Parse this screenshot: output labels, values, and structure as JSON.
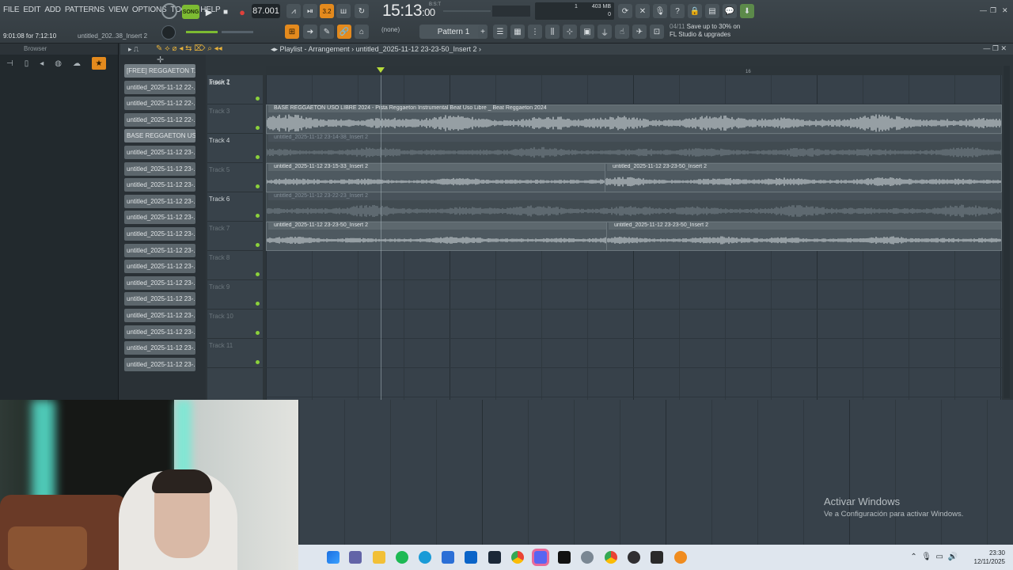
{
  "menu": [
    "FILE",
    "EDIT",
    "ADD",
    "PATTERNS",
    "VIEW",
    "OPTIONS",
    "TOOLS",
    "HELP"
  ],
  "transport": {
    "song_label": "SONG",
    "tempo": "87.001",
    "time": "15:13",
    "time_small": ":00",
    "time_meta": "B:S:T"
  },
  "status": {
    "position": "9:01:08 for 7:12:10",
    "file": "untitled_202..38_Insert 2"
  },
  "cpu": {
    "memory": "403 MB",
    "cpu_val": "1",
    "poly": "0"
  },
  "pattern": {
    "none_label": "(none)",
    "selected": "Pattern 1"
  },
  "promo": {
    "count": "04/11",
    "line1": "Save up to 30% on",
    "line2": "FL Studio & upgrades"
  },
  "browser": {
    "title": "Browser"
  },
  "playlist": {
    "title": "Playlist - Arrangement",
    "breadcrumb": "untitled_2025-11-12 23-23-50_Insert 2",
    "ruler_mark": "16",
    "clips_list": [
      "[FREE] REGGAETON T...",
      "untitled_2025-11-12 22-...",
      "untitled_2025-11-12 22-...",
      "untitled_2025-11-12 22-...",
      "BASE REGGAETON US...",
      "untitled_2025-11-12 23-...",
      "untitled_2025-11-12 23-...",
      "untitled_2025-11-12 23-...",
      "untitled_2025-11-12 23-...",
      "untitled_2025-11-12 23-...",
      "untitled_2025-11-12 23-...",
      "untitled_2025-11-12 23-...",
      "untitled_2025-11-12 23-...",
      "untitled_2025-11-12 23-...",
      "untitled_2025-11-12 23-...",
      "untitled_2025-11-12 23-...",
      "untitled_2025-11-12 23-...",
      "untitled_2025-11-12 23-...",
      "untitled_2025-11-12 23-..."
    ],
    "tracks": [
      "Insert 1",
      "Track 2",
      "Track 3",
      "Track 4",
      "Track 5",
      "Track 6",
      "Track 7",
      "Track 8",
      "Track 9",
      "Track 10",
      "Track 11"
    ],
    "clip_labels": {
      "t2": "BASE REGGAETON USO LIBRE 2024 - Pista Reggaeton Instrumental Beat Uso Libre _ Beat Reggaeton 2024",
      "t3": "untitled_2025-11-12 23-14-38_Insert 2",
      "t4a": "untitled_2025-11-12 23-15-33_Insert 2",
      "t4b": "untitled_2025-11-12 23-23-50_Insert 2",
      "t5": "untitled_2025-11-12 23-22-23_Insert 2",
      "t6a": "untitled_2025-11-12 23-23-50_Insert 2",
      "t6b": "untitled_2025-11-12 23-23-50_Insert 2"
    }
  },
  "watermark": {
    "line1": "Activar Windows",
    "line2": "Ve a Configuración para activar Windows."
  },
  "taskbar": {
    "time": "23:30",
    "date": "12/11/2025"
  },
  "colors": {
    "accent_orange": "#e48a1d",
    "song_green": "#7dbb32",
    "record_red": "#e0413b"
  }
}
